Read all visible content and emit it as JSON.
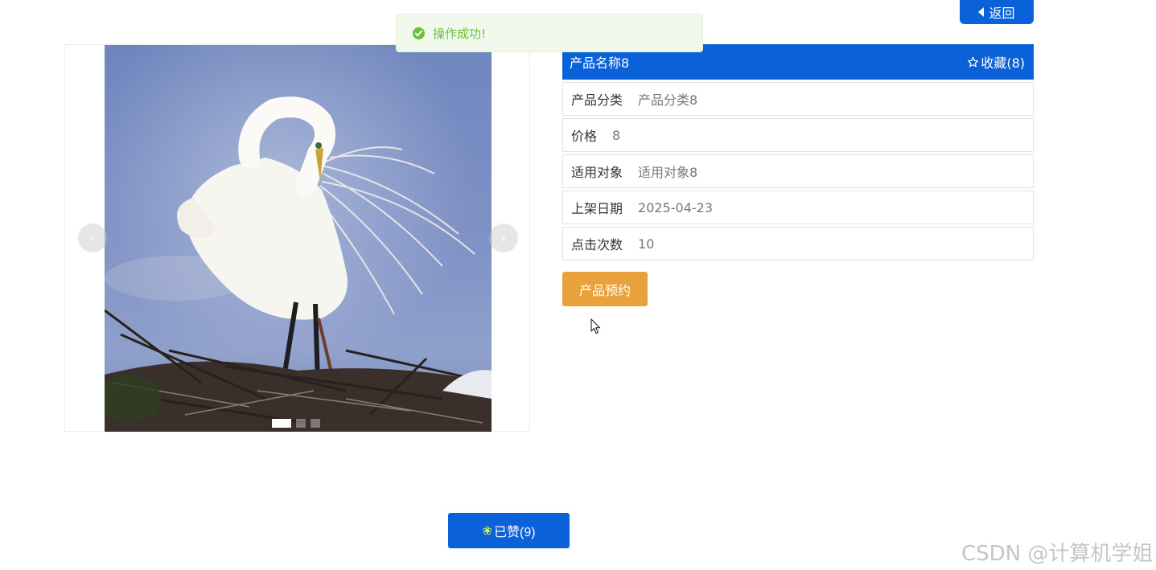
{
  "header": {
    "back_label": "返回"
  },
  "toast": {
    "message": "操作成功!",
    "icon": "check-circle-icon",
    "color": "#67c23a"
  },
  "carousel": {
    "prev_symbol": "‹",
    "next_symbol": "›",
    "slide_count": 3,
    "active_index": 0,
    "image": "white egret preening on a nest of twigs against a blue sky"
  },
  "product": {
    "name": "产品名称8",
    "favorite_label": "收藏(8)",
    "favorite_icon": "star-outline-icon",
    "fields": [
      {
        "label": "产品分类",
        "value": "产品分类8"
      },
      {
        "label": "价格",
        "value": "8"
      },
      {
        "label": "适用对象",
        "value": "适用对象8"
      },
      {
        "label": "上架日期",
        "value": "2025-04-23"
      },
      {
        "label": "点击次数",
        "value": "10"
      }
    ]
  },
  "actions": {
    "book_label": "产品预约",
    "like_label": "已赞(9)",
    "like_icon": "thumbs-up-icon"
  },
  "watermark": "CSDN @计算机学姐",
  "colors": {
    "primary": "#0b61d8",
    "warning": "#e9a23b",
    "success": "#67c23a"
  }
}
